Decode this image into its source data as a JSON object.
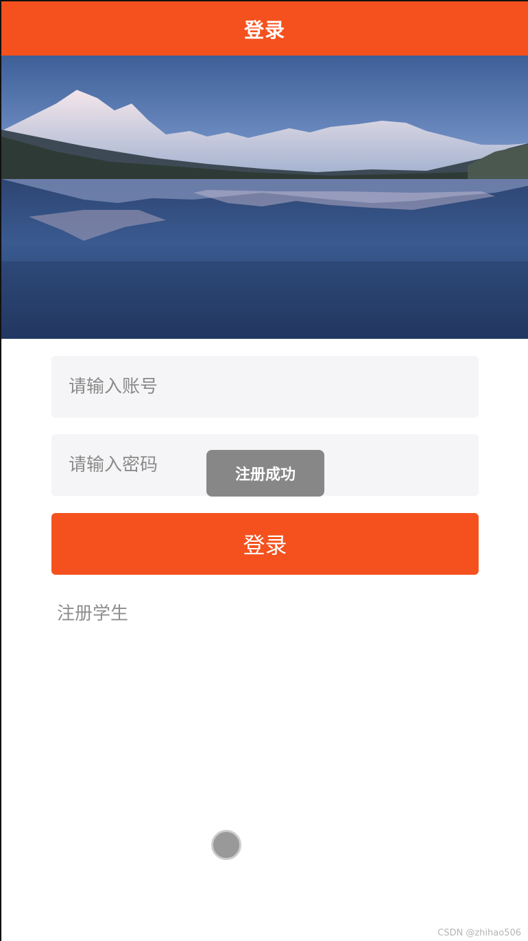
{
  "header": {
    "title": "登录",
    "accent_color": "#f4511e"
  },
  "banner": {
    "image": "mountain-lake-reflection"
  },
  "form": {
    "account_placeholder": "请输入账号",
    "password_placeholder": "请输入密码",
    "account_value": "",
    "password_value": "",
    "login_label": "登录",
    "register_label": "注册学生"
  },
  "toast": {
    "message": "注册成功"
  },
  "watermark": {
    "text": "CSDN @zhihao506"
  }
}
